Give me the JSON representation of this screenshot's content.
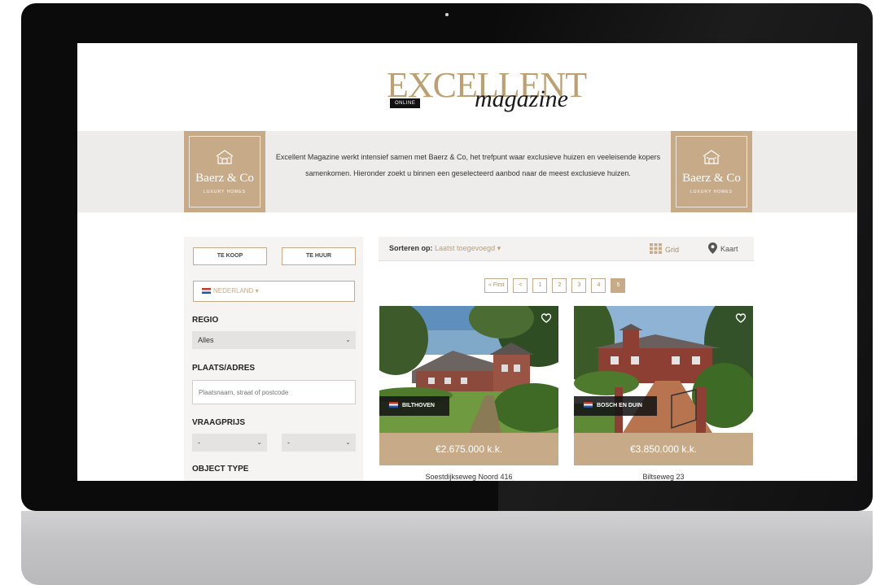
{
  "header": {
    "logo_word": "EXCELLENT",
    "logo_script": "magazine",
    "logo_badge": "ONLINE"
  },
  "intro": {
    "text": "Excellent Magazine werkt intensief samen met Baerz & Co, het trefpunt waar exclusieve huizen en veeleisende kopers samenkomen. Hieronder zoekt u binnen een geselecteerd aanbod naar de meest exclusieve huizen.",
    "partner_name": "Baerz & Co",
    "partner_tagline": "LUXURY HOMES"
  },
  "filters": {
    "buy_label": "TE KOOP",
    "rent_label": "TE HUUR",
    "country": "NEDERLAND ▾",
    "region_label": "REGIO",
    "region_value": "Alles",
    "place_label": "PLAATS/ADRES",
    "place_placeholder": "Plaatsnaam, straat of postcode",
    "price_label": "VRAAGPRIJS",
    "price_min": "-",
    "price_max": "-",
    "object_type_label": "OBJECT TYPE"
  },
  "sort": {
    "label": "Sorteren op:",
    "value": "Laatst toegevoegd ▾",
    "grid_label": "Grid",
    "map_label": "Kaart"
  },
  "pagination": {
    "first": "« First",
    "prev": "<",
    "pages": [
      "1",
      "2",
      "3",
      "4",
      "5"
    ],
    "active": "5"
  },
  "listings": [
    {
      "city": "BILTHOVEN",
      "price": "€2.675.000 k.k.",
      "address": "Soestdijkseweg Noord 416"
    },
    {
      "city": "BOSCH EN DUIN",
      "price": "€3.850.000 k.k.",
      "address": "Biltseweg 23"
    }
  ],
  "colors": {
    "accent": "#c7ab89",
    "logo_gold": "#bda071",
    "band": "#eeecea"
  }
}
